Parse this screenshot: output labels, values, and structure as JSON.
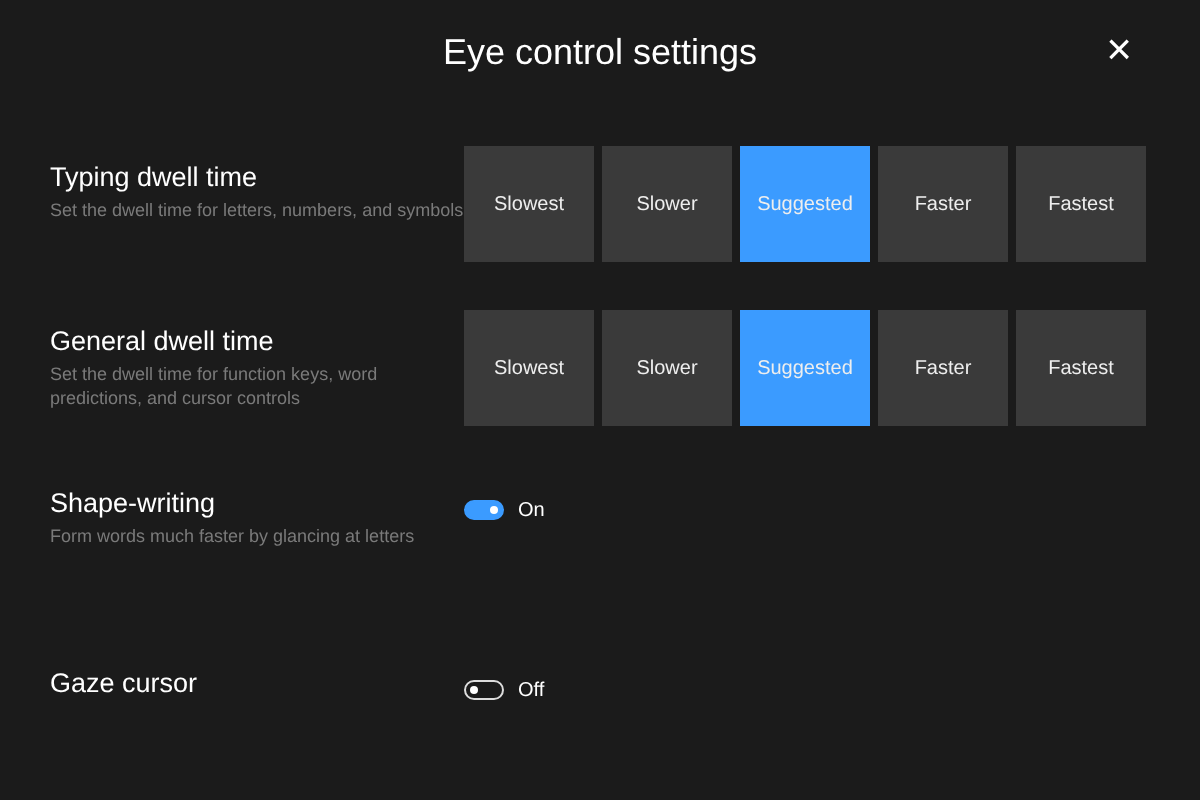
{
  "window": {
    "title": "Eye control settings",
    "close": "×"
  },
  "settings": [
    {
      "kind": "segmented",
      "label": "Typing dwell time",
      "description": "Set the dwell time for letters, numbers, and symbols",
      "options": [
        {
          "label": "Slowest",
          "selected": false
        },
        {
          "label": "Slower",
          "selected": false
        },
        {
          "label": "Suggested",
          "selected": true
        },
        {
          "label": "Faster",
          "selected": false
        },
        {
          "label": "Fastest",
          "selected": false
        }
      ]
    },
    {
      "kind": "segmented",
      "label": "General dwell time",
      "description": "Set the dwell time for function keys, word predictions, and cursor controls",
      "options": [
        {
          "label": "Slowest",
          "selected": false
        },
        {
          "label": "Slower",
          "selected": false
        },
        {
          "label": "Suggested",
          "selected": true
        },
        {
          "label": "Faster",
          "selected": false
        },
        {
          "label": "Fastest",
          "selected": false
        }
      ]
    },
    {
      "kind": "toggle",
      "label": "Shape-writing",
      "description": "Form words much faster by glancing at letters",
      "on": true,
      "state_text": "On"
    },
    {
      "kind": "toggle",
      "label": "Gaze cursor",
      "on": false,
      "state_text": "Off"
    }
  ]
}
